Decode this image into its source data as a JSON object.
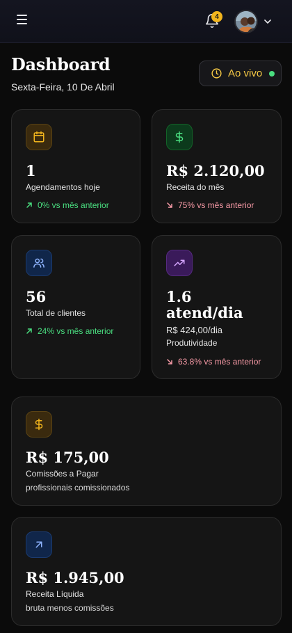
{
  "header": {
    "notifications_count": "4"
  },
  "page": {
    "title": "Dashboard",
    "date": "Sexta-Feira, 10 De Abril",
    "live_label": "Ao vivo"
  },
  "cards": {
    "appointments": {
      "value": "1",
      "label": "Agendamentos hoje",
      "trend": "0% vs mês anterior"
    },
    "revenue": {
      "value": "R$ 2.120,00",
      "label": "Receita do mês",
      "trend": "75% vs mês anterior"
    },
    "clients": {
      "value": "56",
      "label": "Total de clientes",
      "trend": "24% vs mês anterior"
    },
    "productivity": {
      "value_line1": "1.6",
      "value_line2": "atend/dia",
      "per_day": "R$ 424,00/dia",
      "label": "Produtividade",
      "trend": "63.8% vs mês anterior"
    },
    "commissions": {
      "value": "R$ 175,00",
      "label": "Comissões a Pagar",
      "sub": "profissionais comissionados"
    },
    "net_revenue": {
      "value": "R$ 1.945,00",
      "label": "Receita Líquida",
      "sub": "bruta menos comissões"
    }
  },
  "colors": {
    "accent_yellow": "#f6c945",
    "trend_up": "#4ade80",
    "trend_down": "#f79aa6"
  },
  "icons": {
    "menu": "menu-icon",
    "bell": "bell-icon",
    "chevron": "chevron-down-icon",
    "clock": "clock-icon",
    "calendar": "calendar-icon",
    "dollar": "dollar-icon",
    "users": "users-icon",
    "trending_up": "trending-up-icon",
    "arrow_up_right": "arrow-up-right-icon"
  }
}
